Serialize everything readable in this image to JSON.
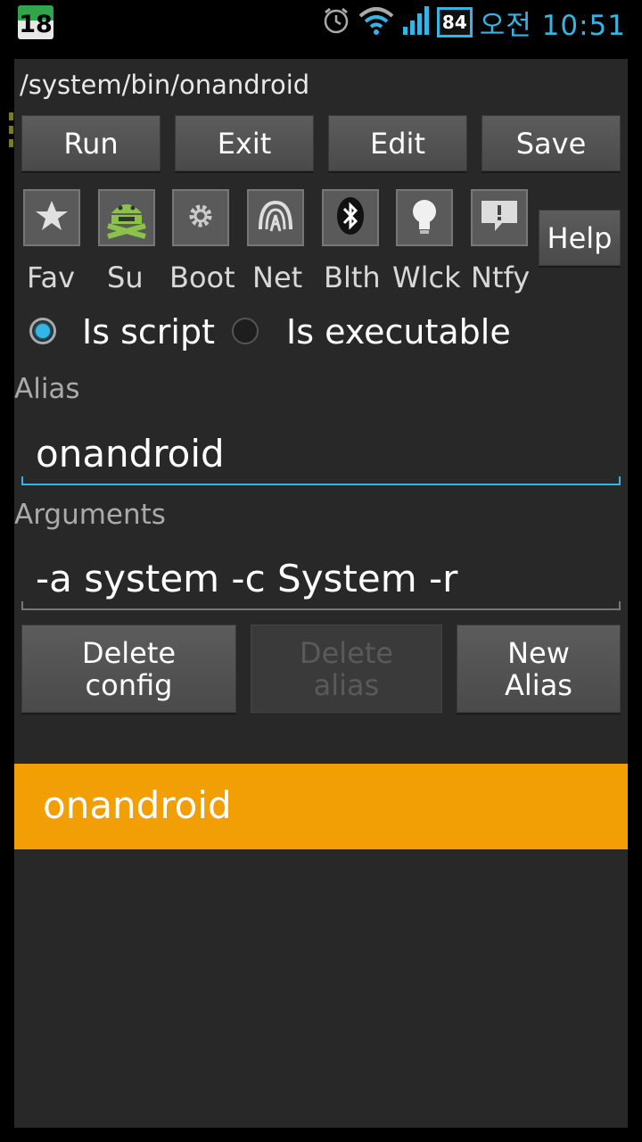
{
  "status_bar": {
    "notification_count": "18",
    "battery": "84",
    "time": "오전 10:51",
    "icons": [
      "alarm-icon",
      "wifi-icon",
      "signal-icon"
    ]
  },
  "dialog": {
    "path": "/system/bin/onandroid",
    "toolbar": {
      "run": "Run",
      "exit": "Exit",
      "edit": "Edit",
      "save": "Save"
    },
    "categories": [
      {
        "label": "Fav",
        "icon": "star-icon"
      },
      {
        "label": "Su",
        "icon": "android-su-icon"
      },
      {
        "label": "Boot",
        "icon": "gear-icon"
      },
      {
        "label": "Net",
        "icon": "network-icon"
      },
      {
        "label": "Blth",
        "icon": "bluetooth-icon"
      },
      {
        "label": "Wlck",
        "icon": "bulb-icon"
      },
      {
        "label": "Ntfy",
        "icon": "notify-icon"
      }
    ],
    "help_label": "Help",
    "type_options": {
      "script": "Is script",
      "executable": "Is executable",
      "selected": "script"
    },
    "alias": {
      "label": "Alias",
      "value": "onandroid"
    },
    "arguments": {
      "label": "Arguments",
      "value": "-a system -c System -r"
    },
    "actions": {
      "delete_config": [
        "Delete",
        "config"
      ],
      "delete_alias": [
        "Delete",
        "alias"
      ],
      "new_alias": [
        "New",
        "Alias"
      ]
    },
    "alias_list": [
      "onandroid"
    ]
  },
  "colors": {
    "accent": "#33b5e5",
    "selected_row": "#f29f05",
    "dialog_bg": "#282828"
  }
}
